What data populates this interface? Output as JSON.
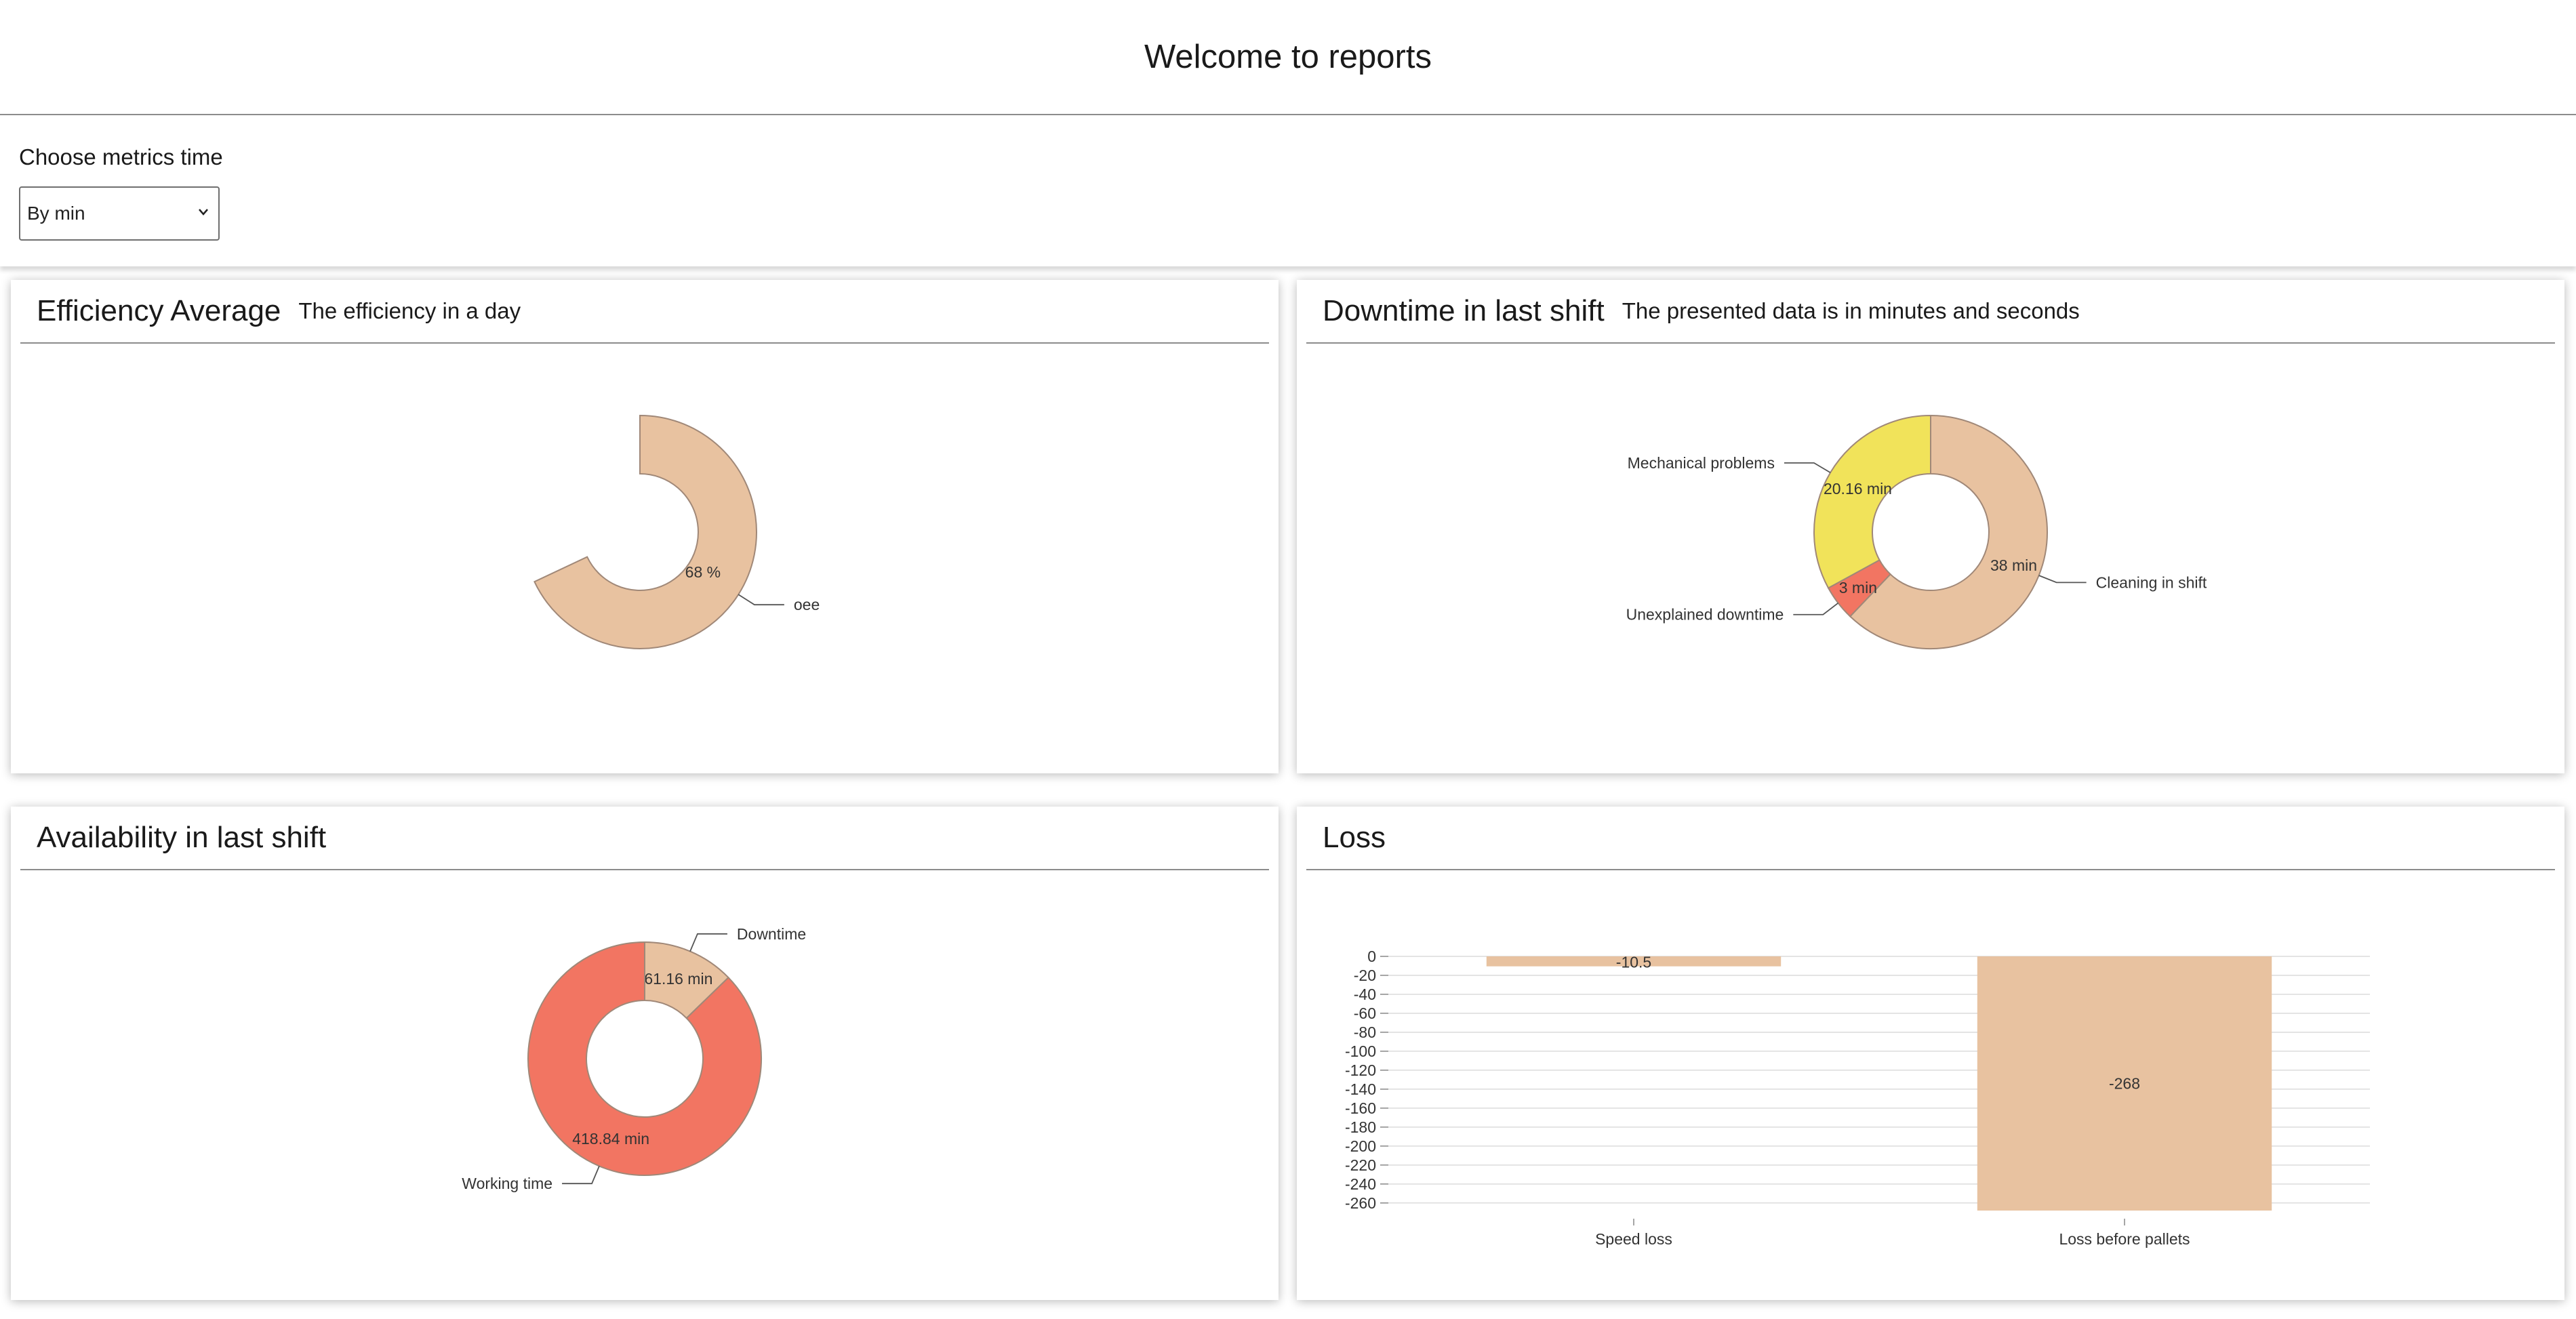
{
  "page": {
    "title": "Welcome to reports"
  },
  "controls": {
    "label": "Choose metrics time",
    "select_value": "By min",
    "chevron_icon": "chevron-down-icon"
  },
  "cards": {
    "efficiency": {
      "title": "Efficiency Average",
      "subtitle": "The efficiency in a day"
    },
    "downtime": {
      "title": "Downtime in last shift",
      "subtitle": "The presented data is in minutes and seconds"
    },
    "availability": {
      "title": "Availability in last shift"
    },
    "loss": {
      "title": "Loss"
    }
  },
  "chart_data": [
    {
      "type": "pie",
      "variant": "donut",
      "card": "efficiency",
      "slices": [
        {
          "label": "oee",
          "value": 68,
          "value_label": "68 %",
          "color": "#e8c2a0"
        }
      ]
    },
    {
      "type": "pie",
      "variant": "donut",
      "card": "downtime",
      "slices": [
        {
          "label": "Cleaning in shift",
          "value": 38,
          "value_label": "38 min",
          "color": "#e8c2a0"
        },
        {
          "label": "Unexplained downtime",
          "value": 3,
          "value_label": "3 min",
          "color": "#f27562"
        },
        {
          "label": "Mechanical problems",
          "value": 20.16,
          "value_label": "20.16 min",
          "color": "#f1e35a"
        }
      ]
    },
    {
      "type": "pie",
      "variant": "donut",
      "card": "availability",
      "slices": [
        {
          "label": "Downtime",
          "value": 61.16,
          "value_label": "61.16 min",
          "color": "#e8c2a0"
        },
        {
          "label": "Working time",
          "value": 418.84,
          "value_label": "418.84 min",
          "color": "#f27562"
        }
      ]
    },
    {
      "type": "bar",
      "card": "loss",
      "categories": [
        "Speed loss",
        "Loss before pallets"
      ],
      "values": [
        -10.5,
        -268
      ],
      "value_labels": [
        "-10.5",
        "-268"
      ],
      "yticks": [
        0,
        -20,
        -40,
        -60,
        -80,
        -100,
        -120,
        -140,
        -160,
        -180,
        -200,
        -220,
        -240,
        -260
      ],
      "ylim": [
        -268,
        0
      ],
      "grid": true,
      "color": "#e8c2a0"
    }
  ]
}
